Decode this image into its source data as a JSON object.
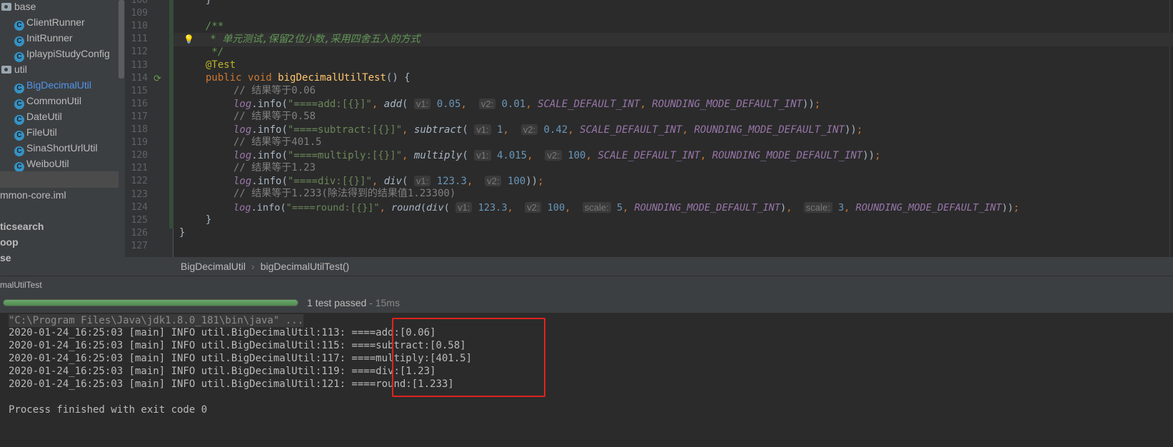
{
  "project_tree": {
    "items": [
      {
        "label": "base",
        "kind": "package",
        "indent": 0
      },
      {
        "label": "ClientRunner",
        "kind": "class",
        "indent": 1
      },
      {
        "label": "InitRunner",
        "kind": "class",
        "indent": 1
      },
      {
        "label": "IplaypiStudyConfig",
        "kind": "class",
        "indent": 1
      },
      {
        "label": "util",
        "kind": "package",
        "indent": 0
      },
      {
        "label": "BigDecimalUtil",
        "kind": "class",
        "indent": 1,
        "active": true
      },
      {
        "label": "CommonUtil",
        "kind": "class",
        "indent": 1
      },
      {
        "label": "DateUtil",
        "kind": "class",
        "indent": 1
      },
      {
        "label": "FileUtil",
        "kind": "class",
        "indent": 1
      },
      {
        "label": "SinaShortUrlUtil",
        "kind": "class",
        "indent": 1
      },
      {
        "label": "WeiboUtil",
        "kind": "class",
        "indent": 1
      },
      {
        "label": "",
        "kind": "blank",
        "indent": 0,
        "selected": true
      },
      {
        "label": "mmon-core.iml",
        "kind": "file",
        "indent": 0
      },
      {
        "label": "",
        "kind": "blank",
        "indent": 0
      },
      {
        "label": "ticsearch",
        "kind": "module",
        "indent": 0
      },
      {
        "label": "oop",
        "kind": "module",
        "indent": 0
      },
      {
        "label": "se",
        "kind": "module",
        "indent": 0
      }
    ],
    "class_icon_letter": "C"
  },
  "editor": {
    "line_numbers": [
      "108",
      "109",
      "110",
      "111",
      "112",
      "113",
      "114",
      "115",
      "116",
      "117",
      "118",
      "119",
      "120",
      "121",
      "122",
      "123",
      "124",
      "125",
      "126",
      "127"
    ],
    "code": {
      "l108": "}",
      "l110": "/**",
      "l111": " * 单元测试,保留2位小数,采用四舍五入的方式",
      "l112": " */",
      "l113_ann": "@Test",
      "l114_kw1": "public",
      "l114_kw2": "void",
      "l114_fn": "bigDecimalUtilTest",
      "l114_rest": "() {",
      "c115": "// 结果等于0.06",
      "c117": "// 结果等于0.58",
      "c119": "// 结果等于401.5",
      "c121": "// 结果等于1.23",
      "c123": "// 结果等于1.233(除法得到的结果值1.23300)",
      "log": "log",
      "info": ".info(",
      "s116": "\"====add:[{}]\"",
      "s118": "\"====subtract:[{}]\"",
      "s120": "\"====multiply:[{}]\"",
      "s122": "\"====div:[{}]\"",
      "s124": "\"====round:[{}]\"",
      "m_add": "add",
      "m_subtract": "subtract",
      "m_multiply": "multiply",
      "m_div": "div",
      "m_round": "round",
      "h_v1": "v1:",
      "h_v2": "v2:",
      "h_scale": "scale:",
      "n116a": "0.05",
      "n116b": "0.01",
      "n118a": "1",
      "n118b": "0.42",
      "n120a": "4.015",
      "n120b": "100",
      "n122a": "123.3",
      "n122b": "100",
      "n124a": "123.3",
      "n124b": "100",
      "n124c": "5",
      "n124d": "3",
      "c_scale": "SCALE_DEFAULT_INT",
      "c_round": "ROUNDING_MODE_DEFAULT_INT",
      "l125": "}",
      "l126": "}"
    }
  },
  "breadcrumb": {
    "class": "BigDecimalUtil",
    "method": "bigDecimalUtilTest()",
    "separator": "›"
  },
  "run_panel": {
    "tab_title": "malUtilTest",
    "progress_fraction": 1.0,
    "status": "1 test passed",
    "duration": " - 15ms",
    "console": {
      "command": "\"C:\\Program Files\\Java\\jdk1.8.0_181\\bin\\java\" ...",
      "lines": [
        "2020-01-24_16:25:03 [main] INFO util.BigDecimalUtil:113: ====add:[0.06]",
        "2020-01-24_16:25:03 [main] INFO util.BigDecimalUtil:115: ====subtract:[0.58]",
        "2020-01-24_16:25:03 [main] INFO util.BigDecimalUtil:117: ====multiply:[401.5]",
        "2020-01-24_16:25:03 [main] INFO util.BigDecimalUtil:119: ====div:[1.23]",
        "2020-01-24_16:25:03 [main] INFO util.BigDecimalUtil:121: ====round:[1.233]"
      ],
      "finish": "Process finished with exit code 0"
    }
  },
  "colors": {
    "highlight_box": "#e0231e",
    "progress_green": "#5e9e5e"
  }
}
